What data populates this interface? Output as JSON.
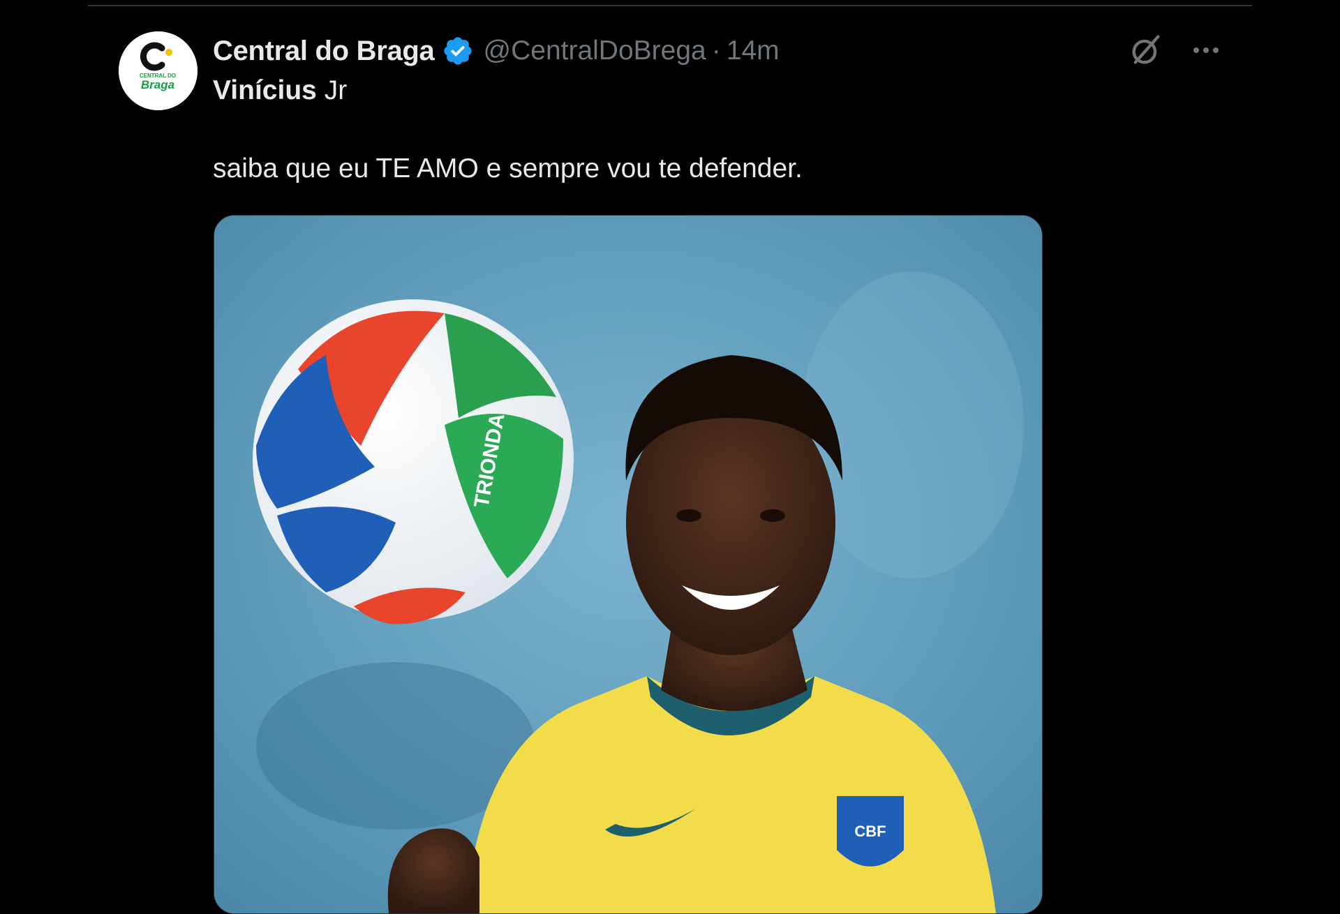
{
  "tweet": {
    "display_name": "Central do Braga",
    "handle": "@CentralDoBrega",
    "separator": "·",
    "time": "14m",
    "reply_to": {
      "strong": "Vinícius",
      "light": "Jr"
    },
    "text": "saiba que eu TE AMO e sempre vou te defender.",
    "avatar": {
      "logo_letter": "C",
      "logo_top_text": "CENTRAL DO",
      "logo_brand_text": "Braga"
    },
    "media": {
      "ball_brand": "TRIONDA",
      "crest_text": "CBF"
    }
  },
  "icons": {
    "verified": "verified-badge-icon",
    "grok": "grok-icon",
    "more": "more-icon"
  },
  "colors": {
    "background": "#000000",
    "text_primary": "#e7e9ea",
    "text_secondary": "#71767b",
    "verified_blue": "#1d9bf0",
    "divider": "#2f3336",
    "photo_backdrop": "#5e9ab9",
    "shirt_yellow": "#f2dc4a"
  }
}
